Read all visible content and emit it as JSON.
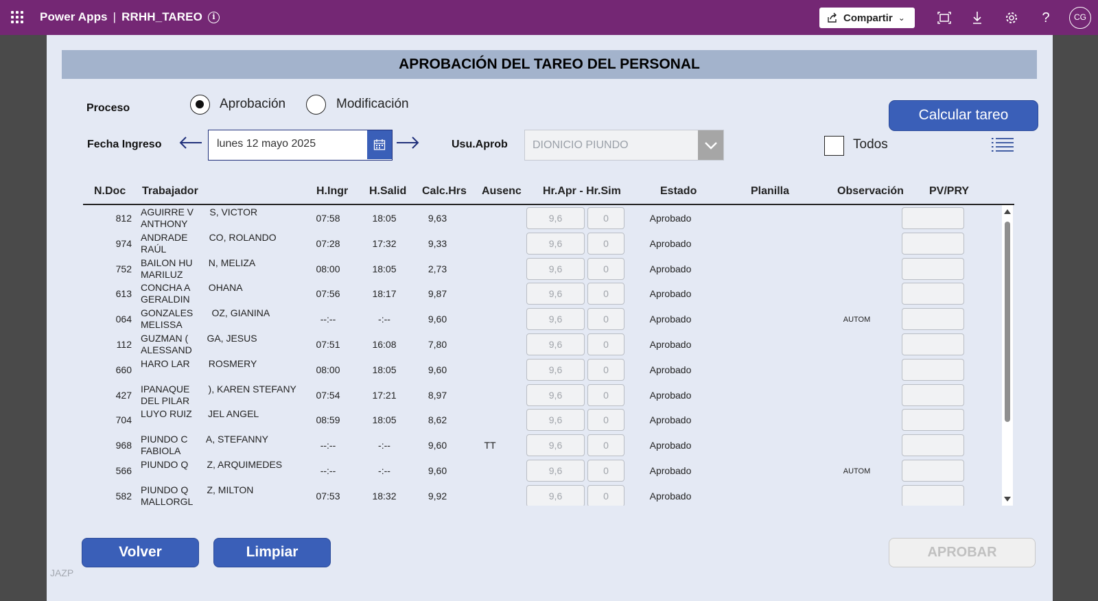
{
  "topbar": {
    "app_name": "Power Apps",
    "separator": "|",
    "app_title": "RRHH_TAREO",
    "share_label": "Compartir",
    "avatar_initials": "CG"
  },
  "page": {
    "title": "APROBACIÓN DEL TAREO DEL PERSONAL",
    "proceso_label": "Proceso",
    "radio_aprobacion": "Aprobación",
    "radio_modificacion": "Modificación",
    "selected_process": "Aprobación",
    "calcular_label": "Calcular tareo",
    "fecha_label": "Fecha Ingreso",
    "fecha_value": "lunes 12 mayo 2025",
    "usu_label": "Usu.Aprob",
    "usu_value": "DIONICIO PIUNDO",
    "todos_label": "Todos",
    "todos_checked": false
  },
  "table": {
    "headers": {
      "doc": "N.Doc",
      "trabajador": "Trabajador",
      "ingr": "H.Ingr",
      "salid": "H.Salid",
      "calc": "Calc.Hrs",
      "ausenc": "Ausenc",
      "apr_sim": "Hr.Apr - Hr.Sim",
      "estado": "Estado",
      "planilla": "Planilla",
      "observacion": "Observación",
      "pvpry": "PV/PRY"
    },
    "rows": [
      {
        "doc": "812",
        "name": "AGUIRRE V      S, VICTOR\nANTHONY",
        "ingr": "07:58",
        "salid": "18:05",
        "calc": "9,63",
        "ausenc": "",
        "apr": "9,6",
        "sim": "0",
        "estado": "Aprobado",
        "obs": ""
      },
      {
        "doc": "974",
        "name": "ANDRADE        CO, ROLANDO\nRAÚL",
        "ingr": "07:28",
        "salid": "17:32",
        "calc": "9,33",
        "ausenc": "",
        "apr": "9,6",
        "sim": "0",
        "estado": "Aprobado",
        "obs": ""
      },
      {
        "doc": "752",
        "name": "BAILON HU      N, MELIZA\nMARILUZ",
        "ingr": "08:00",
        "salid": "18:05",
        "calc": "2,73",
        "ausenc": "",
        "apr": "9,6",
        "sim": "0",
        "estado": "Aprobado",
        "obs": ""
      },
      {
        "doc": "613",
        "name": "CONCHA A       OHANA\nGERALDIN",
        "ingr": "07:56",
        "salid": "18:17",
        "calc": "9,87",
        "ausenc": "",
        "apr": "9,6",
        "sim": "0",
        "estado": "Aprobado",
        "obs": ""
      },
      {
        "doc": "064",
        "name": "GONZALES       OZ, GIANINA\nMELISSA",
        "ingr": "--:--",
        "salid": "-:--",
        "calc": "9,60",
        "ausenc": "",
        "apr": "9,6",
        "sim": "0",
        "estado": "Aprobado",
        "obs": "AUTOM"
      },
      {
        "doc": "112",
        "name": "GUZMAN (       GA, JESUS\nALESSAND",
        "ingr": "07:51",
        "salid": "16:08",
        "calc": "7,80",
        "ausenc": "",
        "apr": "9,6",
        "sim": "0",
        "estado": "Aprobado",
        "obs": ""
      },
      {
        "doc": "660",
        "name": "HARO LAR       ROSMERY",
        "ingr": "08:00",
        "salid": "18:05",
        "calc": "9,60",
        "ausenc": "",
        "apr": "9,6",
        "sim": "0",
        "estado": "Aprobado",
        "obs": ""
      },
      {
        "doc": "427",
        "name": "IPANAQUE       ), KAREN STEFANY\nDEL PILAR",
        "ingr": "07:54",
        "salid": "17:21",
        "calc": "8,97",
        "ausenc": "",
        "apr": "9,6",
        "sim": "0",
        "estado": "Aprobado",
        "obs": ""
      },
      {
        "doc": "704",
        "name": "LUYO RUIZ      JEL ANGEL",
        "ingr": "08:59",
        "salid": "18:05",
        "calc": "8,62",
        "ausenc": "",
        "apr": "9,6",
        "sim": "0",
        "estado": "Aprobado",
        "obs": ""
      },
      {
        "doc": "968",
        "name": "PIUNDO C       A, STEFANNY\nFABIOLA",
        "ingr": "--:--",
        "salid": "-:--",
        "calc": "9,60",
        "ausenc": "TT",
        "apr": "9,6",
        "sim": "0",
        "estado": "Aprobado",
        "obs": ""
      },
      {
        "doc": "566",
        "name": "PIUNDO Q       Z, ARQUIMEDES",
        "ingr": "--:--",
        "salid": "-:--",
        "calc": "9,60",
        "ausenc": "",
        "apr": "9,6",
        "sim": "0",
        "estado": "Aprobado",
        "obs": "AUTOM"
      },
      {
        "doc": "582",
        "name": "PIUNDO Q       Z, MILTON\nMALLORGL",
        "ingr": "07:53",
        "salid": "18:32",
        "calc": "9,92",
        "ausenc": "",
        "apr": "9,6",
        "sim": "0",
        "estado": "Aprobado",
        "obs": ""
      }
    ]
  },
  "footer": {
    "volver_label": "Volver",
    "limpiar_label": "Limpiar",
    "aprobar_label": "APROBAR",
    "watermark": "JAZP"
  },
  "colors": {
    "topbar": "#742774",
    "canvas": "#e4e9f4",
    "title_bar": "#a3b3cc",
    "primary_button": "#3a5fb8"
  }
}
